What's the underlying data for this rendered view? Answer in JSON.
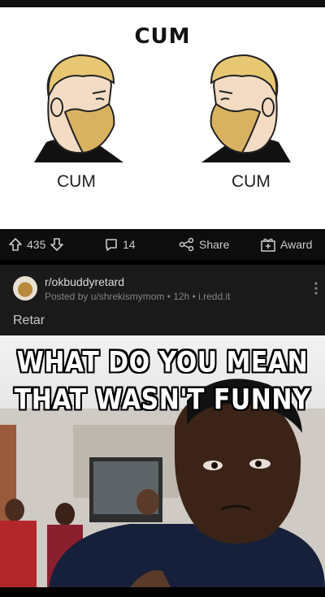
{
  "meme_top": {
    "title": "CUM",
    "left_label": "CUM",
    "right_label": "CUM"
  },
  "action_bar": {
    "votes": "435",
    "comments": "14",
    "share_label": "Share",
    "award_label": "Award"
  },
  "post": {
    "subreddit": "r/okbuddyretard",
    "meta": "Posted by u/shrekismymom • 12h • i.redd.it",
    "title": "Retar"
  },
  "meme_bottom": {
    "caption_line1": "WHAT DO YOU MEAN",
    "caption_line2": "THAT WASN'T FUNNY"
  },
  "colors": {
    "background": "#000000",
    "card": "#1a1a1b",
    "text": "#d7dadc",
    "muted": "#818384"
  }
}
